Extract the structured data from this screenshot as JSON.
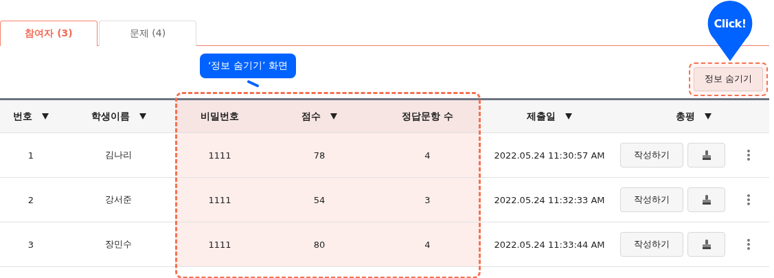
{
  "tabs": [
    {
      "label": "참여자 (3)",
      "selected": true
    },
    {
      "label": "문제 (4)",
      "selected": false
    }
  ],
  "hide_button": {
    "label": "정보 숨기기",
    "emphasized": true
  },
  "callout": {
    "text": "‘정보 숨기기’ 화면"
  },
  "click_pin": {
    "text": "Click!"
  },
  "table": {
    "columns": [
      {
        "label": "번호",
        "sortable": true,
        "highlighted": false
      },
      {
        "label": "학생이름",
        "sortable": true,
        "highlighted": false
      },
      {
        "label": "비밀번호",
        "sortable": false,
        "highlighted": true
      },
      {
        "label": "점수",
        "sortable": true,
        "highlighted": true
      },
      {
        "label": "정답문항 수",
        "sortable": false,
        "highlighted": true
      },
      {
        "label": "제출일",
        "sortable": true,
        "highlighted": false
      },
      {
        "label": "총평",
        "sortable": true,
        "highlighted": false
      }
    ],
    "rows": [
      {
        "cells": [
          "1",
          "김나리",
          "1111",
          "78",
          "4",
          "2022.05.24 11:30:57 AM"
        ],
        "action": "작성하기"
      },
      {
        "cells": [
          "2",
          "강서준",
          "1111",
          "54",
          "3",
          "2022.05.24 11:32:33 AM"
        ],
        "action": "작성하기"
      },
      {
        "cells": [
          "3",
          "장민수",
          "1111",
          "80",
          "4",
          "2022.05.24 11:33:44 AM"
        ],
        "action": "작성하기"
      }
    ]
  }
}
